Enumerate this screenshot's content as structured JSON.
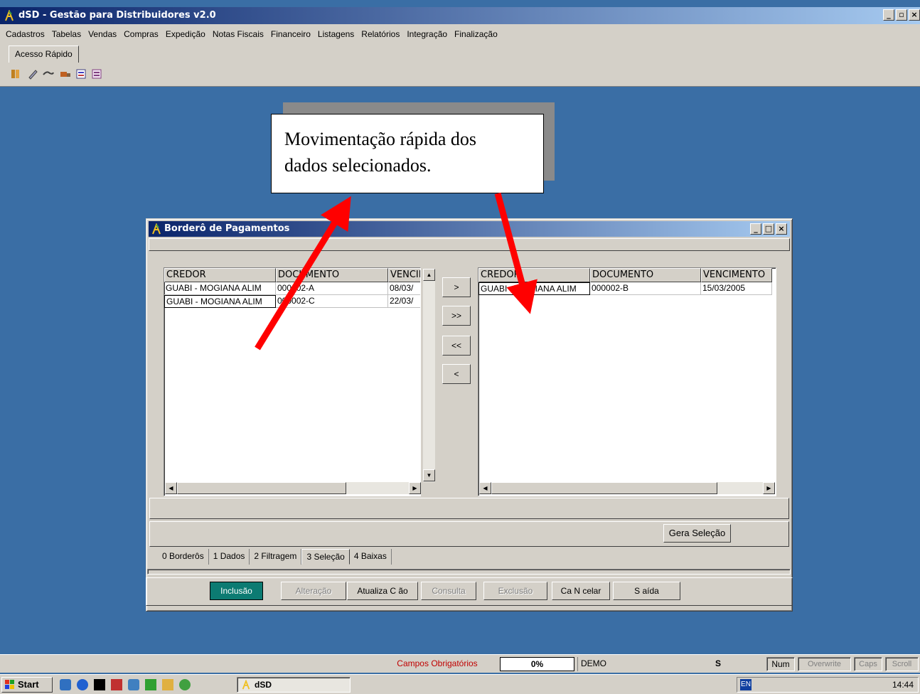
{
  "app": {
    "title": "dSD - Gestão para Distribuidores v2.0",
    "window_buttons": [
      "_",
      "🗗",
      "×"
    ]
  },
  "menu": [
    "Cadastros",
    "Tabelas",
    "Vendas",
    "Compras",
    "Expedição",
    "Notas Fiscais",
    "Financeiro",
    "Listagens",
    "Relatórios",
    "Integração",
    "Finalização"
  ],
  "quick_access_tab": "Acesso Rápido",
  "toolbar_icons": [
    "book-icon",
    "pen-icon",
    "handshake-icon",
    "truck-icon",
    "report-icon",
    "document-icon"
  ],
  "callout": {
    "text_line1": "Movimentação rápida dos",
    "text_line2": "dados selecionados."
  },
  "dialog": {
    "title": "Borderô de Pagamentos",
    "left_grid": {
      "columns": [
        "CREDOR",
        "DOCUMENTO",
        "VENCIMENTO"
      ],
      "rows": [
        [
          "GUABI - MOGIANA ALIM",
          "000002-A",
          "08/03/"
        ],
        [
          "GUABI - MOGIANA ALIM",
          "000002-C",
          "22/03/"
        ]
      ]
    },
    "right_grid": {
      "columns": [
        "CREDOR",
        "DOCUMENTO",
        "VENCIMENTO"
      ],
      "rows": [
        [
          "GUABI - MOGIANA ALIM",
          "000002-B",
          "15/03/2005"
        ]
      ]
    },
    "move_buttons": [
      ">",
      ">>",
      "<<",
      "<"
    ],
    "gera_selecao": "Gera Seleção",
    "tabs": [
      "0 Borderôs",
      "1 Dados",
      "2 Filtragem",
      "3 Seleção",
      "4 Baixas"
    ],
    "active_tab": "2 Filtragem",
    "actions": {
      "inclusao": "Inclusão",
      "alteracao": "Alteração",
      "atualiza": "Atualiza C ão",
      "consulta": "Consulta",
      "exclusao": "Exclusão",
      "cancelar": "Ca N celar",
      "saida": "S aída"
    }
  },
  "statusbar": {
    "required": "Campos Obrigatórios",
    "progress": "0%",
    "mode": "DEMO",
    "s": "S",
    "num": "Num",
    "overwrite": "Overwrite",
    "caps": "Caps",
    "scroll": "Scroll"
  },
  "taskbar": {
    "start": "Start",
    "task": "dSD",
    "lang": "EN",
    "time": "14:44"
  },
  "colors": {
    "desktop": "#3a6ea5",
    "accent_arrow": "#ff0000",
    "active_button": "#0c7b72"
  }
}
